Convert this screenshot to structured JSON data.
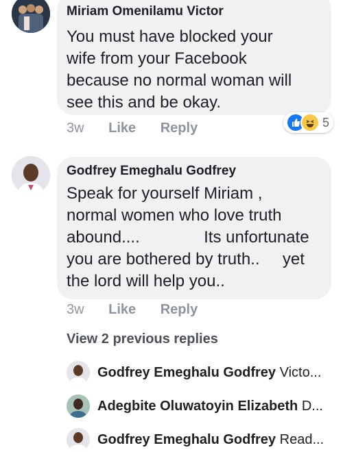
{
  "comments": [
    {
      "author": "Miriam Omenilamu Victor",
      "text": "You must have blocked your\nwife from your Facebook\nbecause no normal woman will\nsee this and be okay.",
      "time": "3w",
      "like_label": "Like",
      "reply_label": "Reply",
      "reaction_count": "5",
      "reactions": [
        "like-icon",
        "haha-icon"
      ]
    },
    {
      "author": "Godfrey Emeghalu Godfrey",
      "text": "Speak for yourself Miriam ,\nnormal women who love truth\nabound....              Its unfortunate\nyou are bothered by truth..     yet\nthe lord will help you..",
      "time": "3w",
      "like_label": "Like",
      "reply_label": "Reply"
    }
  ],
  "view_previous": "View 2 previous replies",
  "replies": [
    {
      "author": "Godfrey Emeghalu Godfrey",
      "preview": "Victo..."
    },
    {
      "author": "Adegbite Oluwatoyin Elizabeth",
      "preview": "D..."
    },
    {
      "author": "Godfrey Emeghalu Godfrey",
      "preview": "Read..."
    }
  ],
  "colors": {
    "bubble": "#eff1f3",
    "meta": "#8d949e",
    "like_blue": "#1877f2",
    "haha_yellow": "#f7c94b"
  }
}
